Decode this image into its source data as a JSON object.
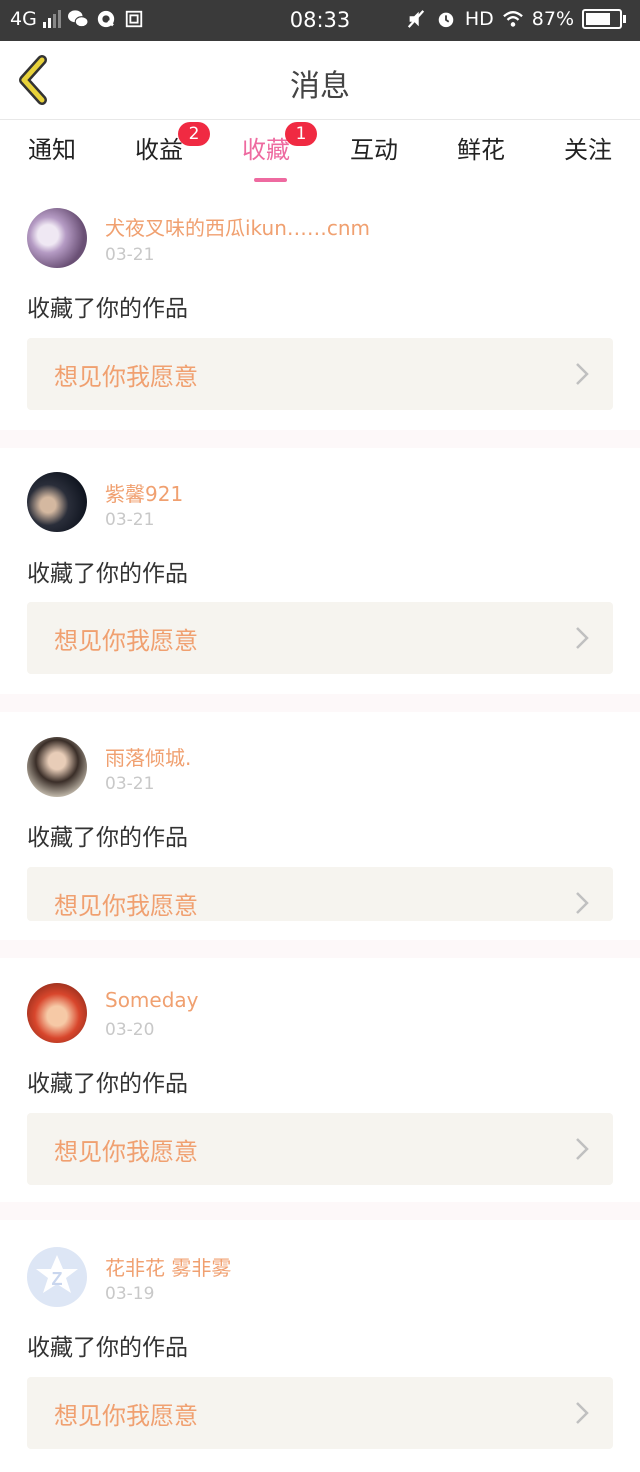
{
  "status_bar": {
    "network": "4G",
    "time": "08:33",
    "hd": "HD",
    "battery": "87%",
    "battery_level": 0.87
  },
  "header": {
    "title": "消息",
    "back_icon": "chevron-left-icon"
  },
  "tabs": [
    {
      "label": "通知",
      "badge": ""
    },
    {
      "label": "收益",
      "badge": "2"
    },
    {
      "label": "收藏",
      "badge": "1",
      "active": true
    },
    {
      "label": "互动",
      "badge": ""
    },
    {
      "label": "鲜花",
      "badge": ""
    },
    {
      "label": "关注",
      "badge": ""
    }
  ],
  "feed": [
    {
      "name": "犬夜叉味的西瓜ikun……cnm",
      "date": "03-21",
      "action": "收藏了你的作品",
      "work_title": "想见你我愿意"
    },
    {
      "name": "紫馨921",
      "date": "03-21",
      "action": "收藏了你的作品",
      "work_title": "想见你我愿意"
    },
    {
      "name": "雨落倾城.",
      "date": "03-21",
      "action": "收藏了你的作品",
      "work_title": "想见你我愿意"
    },
    {
      "name": "Someday",
      "date": "03-20",
      "action": "收藏了你的作品",
      "work_title": "想见你我愿意"
    },
    {
      "name": "花非花 雾非雾",
      "date": "03-19",
      "action": "收藏了你的作品",
      "work_title": "想见你我愿意"
    }
  ],
  "colors": {
    "accent": "#ee6aa0",
    "badge": "#f02a42",
    "username": "#f0a070",
    "card_bg": "#f6f4ef",
    "back_icon": "#e8d23a"
  }
}
